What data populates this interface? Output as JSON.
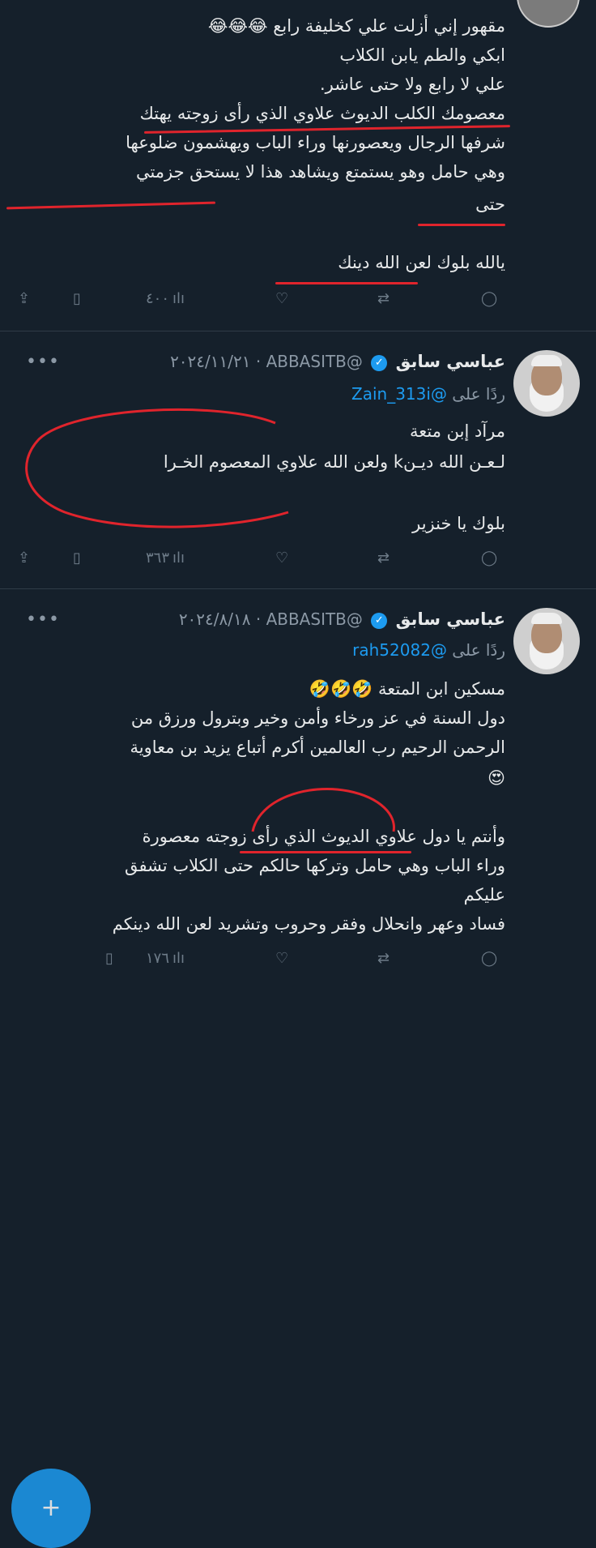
{
  "tweet1": {
    "lines": [
      "مقهور إني أزلت علي كخليفة رابع 😂😂😂",
      "ابكي والطم يابن الكلاب",
      "علي لا رابع ولا حتى عاشر.",
      "معصومك الكلب الديوث علاوي الذي رأى زوجته يهتك",
      "شرفها الرجال ويعصورنها وراء الباب ويهشمون ضلوعها",
      "وهي حامل وهو يستمتع ويشاهد هذا لا يستحق جزمتي",
      "حتى",
      "يالله بلوك لعن الله دينك"
    ],
    "views": "٤٠٠"
  },
  "tweet2": {
    "name": "عباسي سابق",
    "handle": "@ABBASITB",
    "date": "٢٠٢٤/١١/٢١",
    "reply_prefix": "ردًا على",
    "reply_handle": "@Zain_313i",
    "lines": [
      "مرآد إبن متعة",
      "لـعـن الله ديـنk ولعن الله علاوي المعصوم الخـرا",
      "بلوك يا خنزير"
    ],
    "views": "٣٦٣"
  },
  "tweet3": {
    "name": "عباسي سابق",
    "handle": "@ABBASITB",
    "date": "٢٠٢٤/٨/١٨",
    "reply_prefix": "ردًا على",
    "reply_handle": "@rah52082",
    "lines": [
      "مسكين ابن المتعة 🤣🤣🤣",
      "دول السنة في عز ورخاء وأمن وخير وبترول ورزق من",
      "الرحمن الرحيم رب العالمين أكرم أتباع يزيد بن معاوية",
      "😍",
      "وأنتم يا دول علاوي الديوث الذي رأى زوجته معصورة",
      "وراء الباب وهي حامل وتركها حالكم حتى الكلاب تشفق",
      "عليكم",
      "فساد وعهر وانحلال وفقر وحروب وتشريد لعن الله دينكم"
    ],
    "views": "١٧٦"
  },
  "more_label": "•••",
  "dot": "·",
  "colors": {
    "background": "#15202b",
    "accent": "#1d9bf0",
    "annotation": "#e0242c"
  }
}
